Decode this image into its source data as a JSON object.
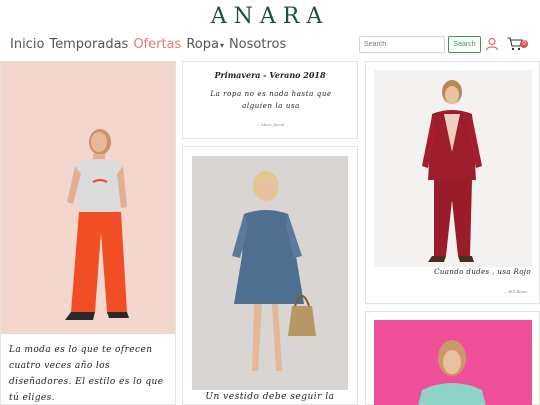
{
  "brand": {
    "logo": "ANARA"
  },
  "nav": {
    "items": [
      {
        "label": "Inicio"
      },
      {
        "label": "Temporadas"
      },
      {
        "label": "Ofertas"
      },
      {
        "label": "Ropa"
      },
      {
        "label": "Nosotros"
      }
    ],
    "active": "Ofertas",
    "active_color": "#e87a6f"
  },
  "search": {
    "placeholder": "Search",
    "button_label": "Search",
    "button_color": "#3a9a4a"
  },
  "cart": {
    "badge": "0",
    "badge_color": "#d9534f"
  },
  "cards": {
    "card1": {
      "quote": "La moda es lo que te ofrecen cuatro veces año los diseñadores. El estilo es lo que tú eliges."
    },
    "card2": {
      "title": "Primavera - Verano 2018",
      "quote": "La ropa no es nada hasta que alguien la usa",
      "author": "— Marc Jacob"
    },
    "card3": {
      "caption": "Un vestido debe seguir la"
    },
    "card4": {
      "caption": "Cuando dudes , usa Rojo",
      "author": "— Bill Blass"
    }
  },
  "icons": [
    "user-icon",
    "cart-icon",
    "caret-down-icon"
  ]
}
